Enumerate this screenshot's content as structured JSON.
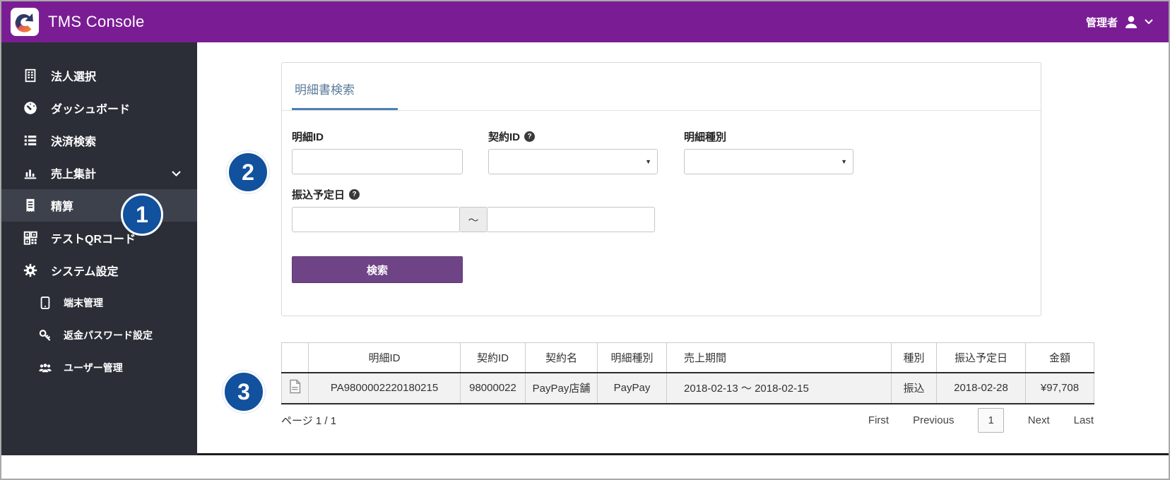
{
  "header": {
    "title": "TMS Console",
    "user_label": "管理者"
  },
  "sidebar": {
    "items": [
      {
        "label": "法人選択"
      },
      {
        "label": "ダッシュボード"
      },
      {
        "label": "決済検索"
      },
      {
        "label": "売上集計"
      },
      {
        "label": "精算"
      },
      {
        "label": "テストQRコード"
      },
      {
        "label": "システム設定"
      },
      {
        "label": "端末管理"
      },
      {
        "label": "返金パスワード設定"
      },
      {
        "label": "ユーザー管理"
      }
    ]
  },
  "search_panel": {
    "tab_label": "明細書検索",
    "meisai_id_label": "明細ID",
    "keiyaku_id_label": "契約ID",
    "meisai_type_label": "明細種別",
    "transfer_date_label": "振込予定日",
    "range_separator": "～",
    "help_glyph": "?",
    "search_button_label": "検索"
  },
  "table": {
    "columns": [
      "",
      "明細ID",
      "契約ID",
      "契約名",
      "明細種別",
      "売上期間",
      "種別",
      "振込予定日",
      "金額"
    ],
    "rows": [
      {
        "meisai_id": "PA9800002220180215",
        "keiyaku_id": "98000022",
        "keiyaku_name": "PayPay店舗",
        "meisai_type": "PayPay",
        "sales_period": "2018-02-13 ～ 2018-02-15",
        "shubetsu": "振込",
        "transfer_date": "2018-02-28",
        "amount": "¥97,708"
      }
    ]
  },
  "pagination": {
    "page_info": "ページ 1 / 1",
    "first_label": "First",
    "previous_label": "Previous",
    "current_page": "1",
    "next_label": "Next",
    "last_label": "Last"
  },
  "annotations": {
    "n1": "1",
    "n2": "2",
    "n3": "3"
  },
  "colors": {
    "header_bg": "#7a1d95",
    "sidebar_bg": "#2b2e37",
    "sidebar_active_bg": "#3d414b",
    "search_button_bg": "#6f4487",
    "tab_underline": "#4d7fb5",
    "annotation_blue": "#11519e",
    "table_row_bg": "#f2f2f2"
  }
}
